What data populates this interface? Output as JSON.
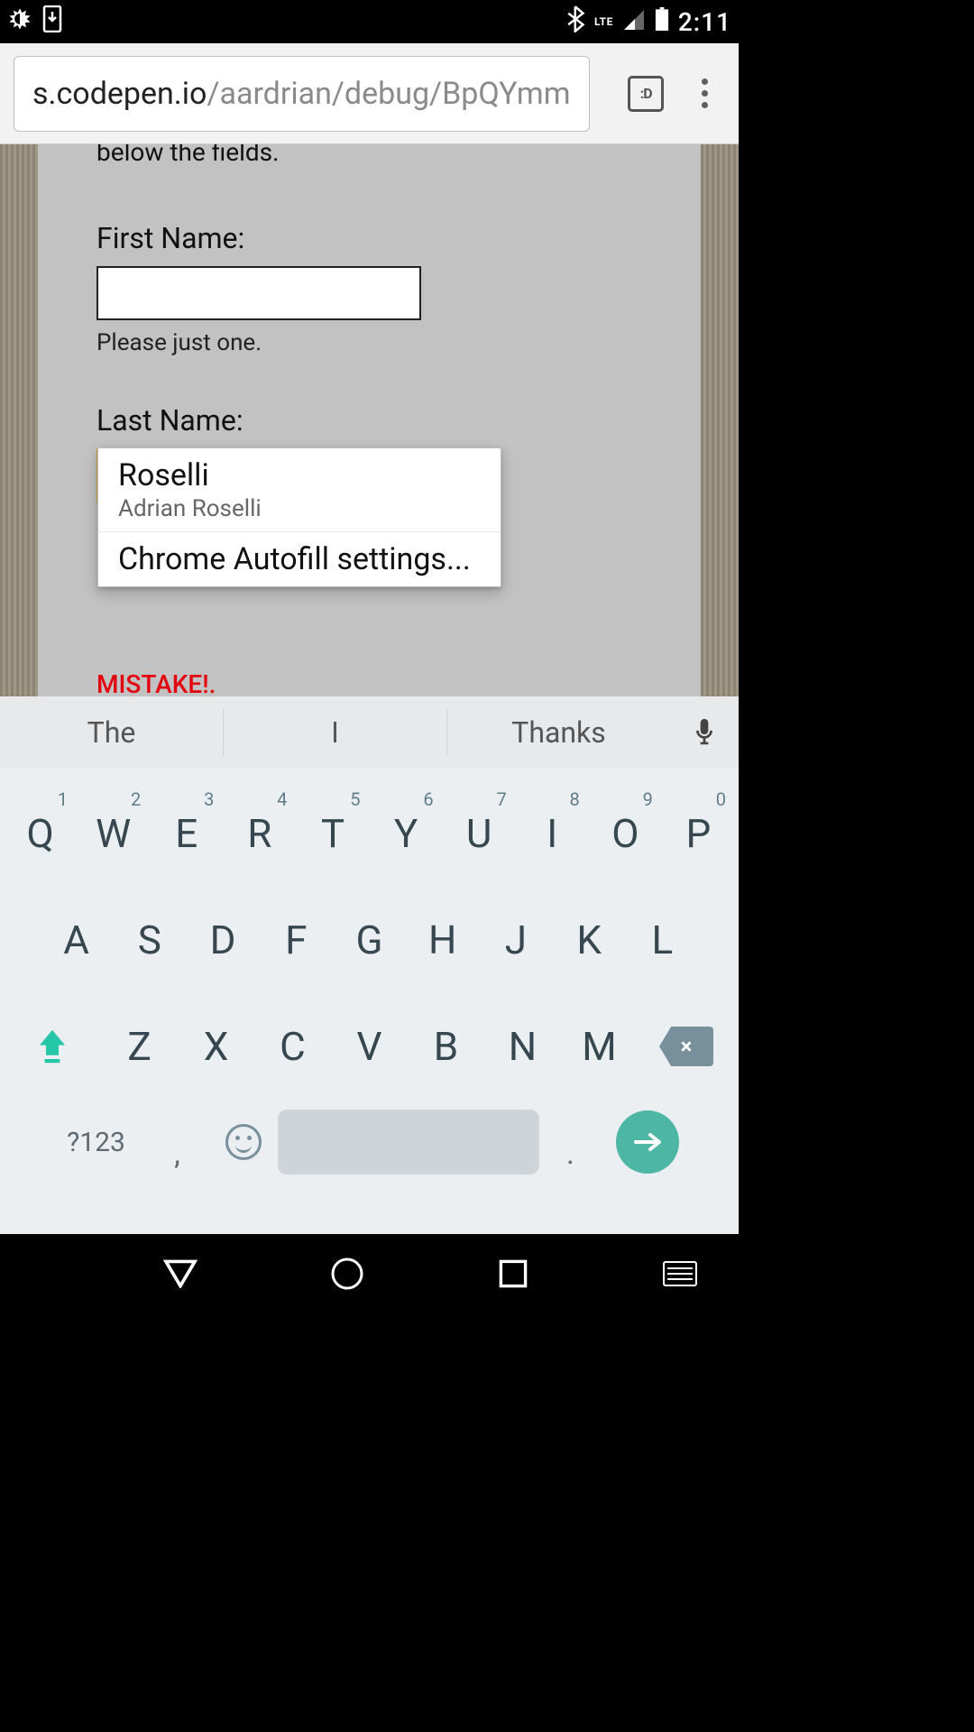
{
  "statusbar": {
    "time": "2:11",
    "network_label": "LTE"
  },
  "toolbar": {
    "url_host": "s.codepen.io",
    "url_path": "/aardrian/debug/BpQYmm",
    "tab_badge": ":D"
  },
  "page": {
    "partial_header": "below the fields.",
    "first_name_label": "First Name:",
    "first_name_value": "",
    "first_name_hint": "Please just one.",
    "last_name_label": "Last Name:",
    "last_name_value": "",
    "error_text": "MISTAKE!."
  },
  "autofill": {
    "suggestion_primary": "Roselli",
    "suggestion_secondary": "Adrian Roselli",
    "settings_label": "Chrome Autofill settings..."
  },
  "ime": {
    "suggestions": [
      "The",
      "I",
      "Thanks"
    ],
    "row1": [
      "Q",
      "W",
      "E",
      "R",
      "T",
      "Y",
      "U",
      "I",
      "O",
      "P"
    ],
    "row1_nums": [
      "1",
      "2",
      "3",
      "4",
      "5",
      "6",
      "7",
      "8",
      "9",
      "0"
    ],
    "row2": [
      "A",
      "S",
      "D",
      "F",
      "G",
      "H",
      "J",
      "K",
      "L"
    ],
    "row3": [
      "Z",
      "X",
      "C",
      "V",
      "B",
      "N",
      "M"
    ],
    "sym_label": "?123",
    "comma": ",",
    "period": "."
  }
}
